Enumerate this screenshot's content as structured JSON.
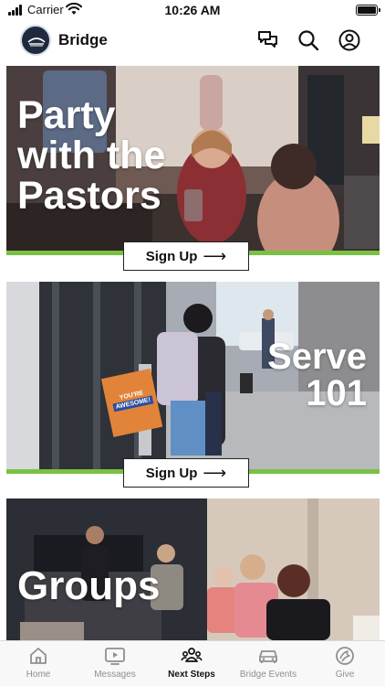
{
  "status_bar": {
    "carrier": "Carrier",
    "time": "10:26 AM"
  },
  "header": {
    "app_name": "Bridge",
    "icons": [
      "logo-icon",
      "chat-icon",
      "search-icon",
      "profile-icon"
    ]
  },
  "cards": [
    {
      "title_lines": [
        "Party",
        "with the",
        "Pastors"
      ],
      "button_label": "Sign Up"
    },
    {
      "title_lines": [
        "Serve",
        "101"
      ],
      "button_label": "Sign Up",
      "sign_text": [
        "YOU'RE",
        "AWESOME!"
      ]
    },
    {
      "title_lines": [
        "Groups"
      ]
    }
  ],
  "tabs": [
    {
      "label": "Home",
      "icon": "home-icon"
    },
    {
      "label": "Messages",
      "icon": "play-icon"
    },
    {
      "label": "Next Steps",
      "icon": "people-icon",
      "active": true
    },
    {
      "label": "Bridge Events",
      "icon": "car-icon"
    },
    {
      "label": "Give",
      "icon": "give-icon"
    }
  ],
  "colors": {
    "accent_green": "#7ac143",
    "logo_navy": "#1f2a3e",
    "tab_inactive": "#8e8e93"
  }
}
